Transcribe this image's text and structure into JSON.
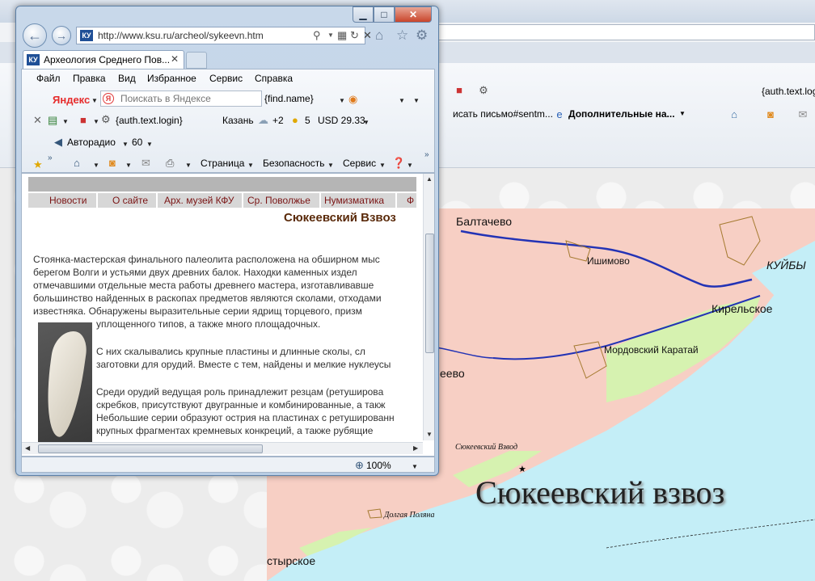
{
  "background_window": {
    "toolbar_text": "{auth.text.login}",
    "favorites": [
      {
        "label": "исать письмо#sentm..."
      },
      {
        "label": "Дополнительные на..."
      }
    ]
  },
  "map": {
    "labels": {
      "baltachevo": "Балтачево",
      "ishimovo": "Ишимово",
      "kuybysh": "КУЙБЫ",
      "kirelskoe": "Кирельское",
      "mordovsky": "Мордовский Каратай",
      "eevo": "еево",
      "syukeev_small": "Сюкеевский Взвод",
      "syukeev_big": "Сюкеевский взвоз",
      "dolgaya": "Долгая Поляна",
      "styrskoe": "стырское"
    },
    "colors": {
      "land": "#f7cfc4",
      "water": "#c4eef7",
      "green": "#d6f2b0",
      "river": "#2333b5"
    }
  },
  "window": {
    "address_url": "http://www.ksu.ru/archeol/sykeevn.htm",
    "favicon_text": "КУ",
    "tab_title": "Археология Среднего Пов...",
    "menu": [
      "Файл",
      "Правка",
      "Вид",
      "Избранное",
      "Сервис",
      "Справка"
    ],
    "yandex_logo": "Яндекс",
    "yandex_search_placeholder": "Поискать в Яндексе",
    "find_name": "{find.name}",
    "auth_login": "{auth.text.login}",
    "city": "Казань",
    "temperature": "+2",
    "traffic": "5",
    "currency": "USD 29.33",
    "radio": "Авторадио",
    "radio_volume": "60",
    "cmd_page": "Страница",
    "cmd_security": "Безопасность",
    "cmd_service": "Сервис",
    "zoom": "100%"
  },
  "page": {
    "nav_links": [
      "Новости",
      "О сайте",
      "Арх. музей КФУ",
      "Ср. Поволжье",
      "Нумизматика",
      "Ф"
    ],
    "heading": "Сюкеевский Взвоз",
    "paragraph1": [
      "Стоянка-мастерская финального палеолита расположена на обширном мыс",
      "берегом Волги и устьями двух древних балок. Находки каменных издел",
      "отмечавшими отдельные места работы древнего мастера, изготавливавше",
      "большинство найденных в раскопах предметов являются сколами, отходами",
      "известняка. Обнаружены выразительные серии ядрищ торцевого, призм",
      "уплощенного типов, а также много площадочных."
    ],
    "paragraph2": [
      "С них скалывались крупные пластины и длинные сколы, сл",
      "заготовки для орудий. Вместе с тем, найдены и мелкие нуклеусы"
    ],
    "paragraph3": [
      "Среди орудий ведущая роль принадлежит резцам (ретушировa",
      "скребков, присутствуют двугранные и комбинированные, а такж",
      "Небольшие серии образуют острия на пластинах с ретушированн",
      "крупных фрагментах кремневых конкреций, а также рубящие"
    ]
  }
}
